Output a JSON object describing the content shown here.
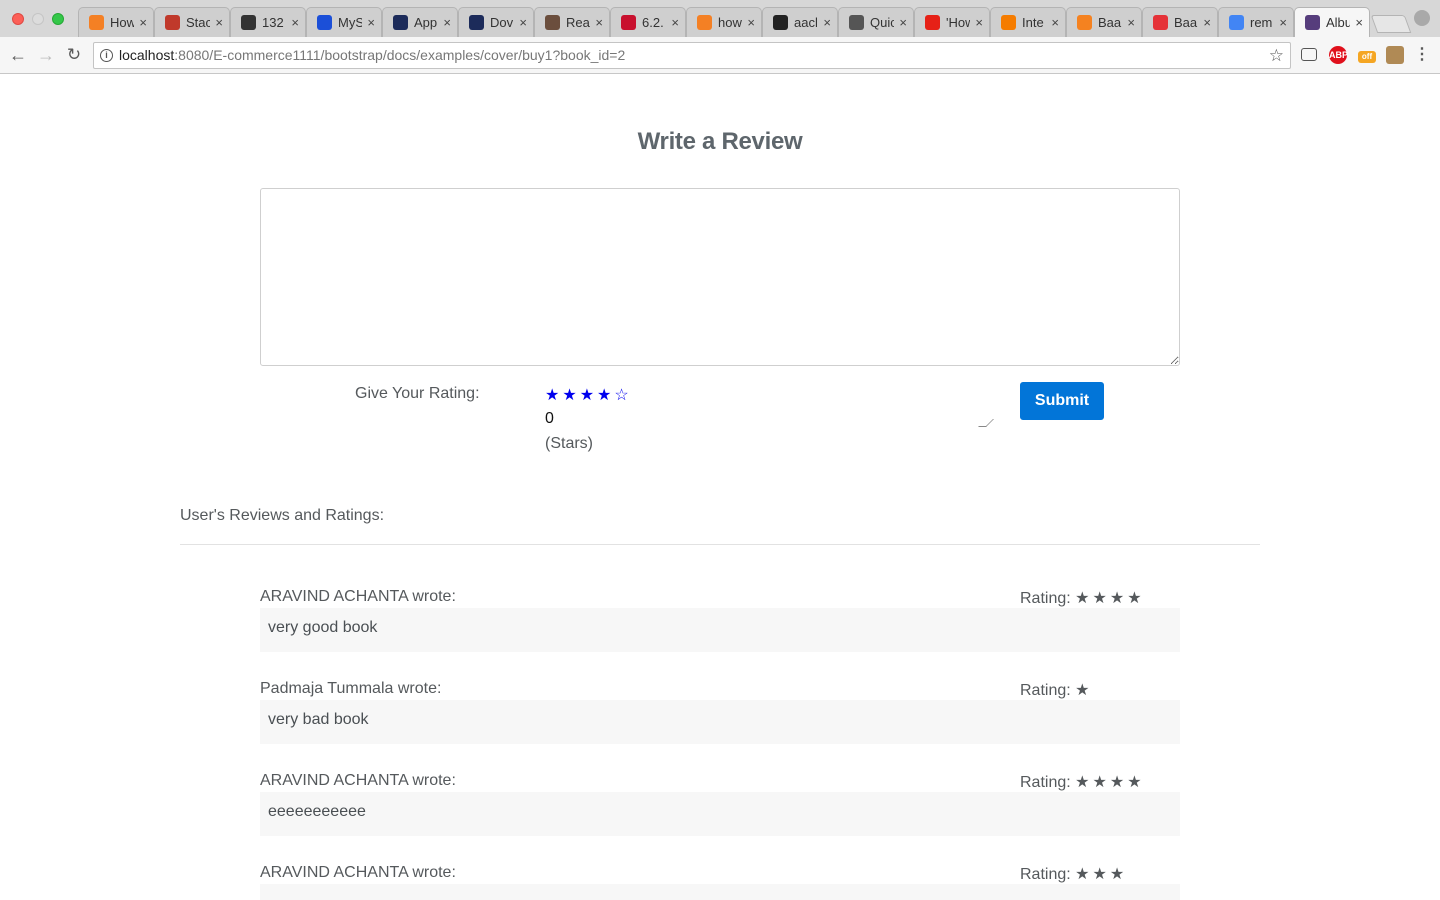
{
  "browser": {
    "tabs": [
      {
        "label": "How",
        "icon": "stackoverflow-icon",
        "color": "#f48024"
      },
      {
        "label": "Stac",
        "icon": "stackexchange-icon",
        "color": "#c0392b"
      },
      {
        "label": "132",
        "icon": "gear-icon",
        "color": "#333333"
      },
      {
        "label": "MyS",
        "icon": "t-letter-icon",
        "color": "#1b4fd8"
      },
      {
        "label": "App",
        "icon": "eye-icon",
        "color": "#1c2b5a"
      },
      {
        "label": "Dov",
        "icon": "eye-icon",
        "color": "#1c2b5a"
      },
      {
        "label": "Rea",
        "icon": "avatar-icon",
        "color": "#6b4e3d"
      },
      {
        "label": "6.2.",
        "icon": "dr-icon",
        "color": "#c8102e"
      },
      {
        "label": "how",
        "icon": "stackoverflow-icon",
        "color": "#f48024"
      },
      {
        "label": "aacl",
        "icon": "github-icon",
        "color": "#222222"
      },
      {
        "label": "Quic",
        "icon": "book-icon",
        "color": "#555555"
      },
      {
        "label": "'How",
        "icon": "youtube-icon",
        "color": "#e62117"
      },
      {
        "label": "Inte",
        "icon": "flame-icon",
        "color": "#f57c00"
      },
      {
        "label": "Baa",
        "icon": "baeldung-icon",
        "color": "#f58220"
      },
      {
        "label": "Baa",
        "icon": "ebay-icon",
        "color": "#e53238"
      },
      {
        "label": "rem",
        "icon": "google-icon",
        "color": "#4285f4"
      },
      {
        "label": "Albu",
        "icon": "bootstrap-icon",
        "color": "#563d7c",
        "active": true
      }
    ],
    "close_glyph": "×",
    "url_host": "localhost",
    "url_path": ":8080/E-commerce1111/bootstrap/docs/examples/cover/buy1?book_id=2",
    "ext_abp": "ABP",
    "ext_off": "off"
  },
  "page": {
    "title": "Write a Review",
    "rating_label": "Give Your Rating:",
    "star_picker": "★★★★☆",
    "rating_value": "0",
    "stars_unit": "(Stars)",
    "submit_label": "Submit",
    "reviews_heading": "User's Reviews and Ratings:",
    "rating_prefix": "Rating:",
    "accent_color": "#0275d8"
  },
  "reviews": [
    {
      "author": "ARAVIND ACHANTA wrote:",
      "stars": "★★★★",
      "rating": 4,
      "text": "very good book"
    },
    {
      "author": "Padmaja Tummala wrote:",
      "stars": "★",
      "rating": 1,
      "text": "very bad book"
    },
    {
      "author": "ARAVIND ACHANTA wrote:",
      "stars": "★★★★",
      "rating": 4,
      "text": "eeeeeeeeeee"
    },
    {
      "author": "ARAVIND ACHANTA wrote:",
      "stars": "★★★",
      "rating": 3,
      "text": ""
    }
  ]
}
